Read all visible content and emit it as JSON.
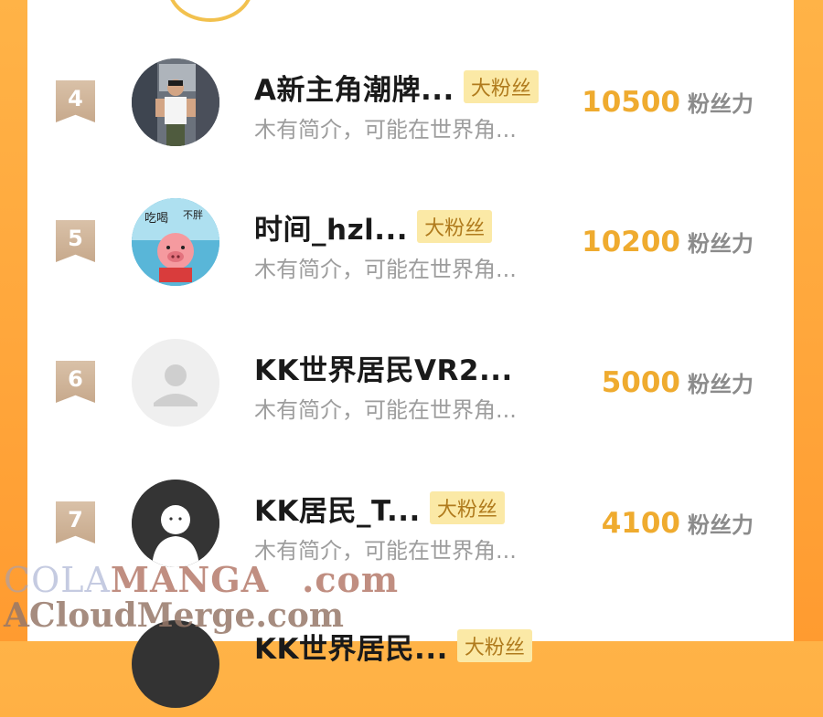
{
  "leaderboard": {
    "rows": [
      {
        "rank": "4",
        "name": "A新主角潮牌...",
        "tag": "大粉丝",
        "bio": "木有简介，可能在世界角...",
        "score": "10500",
        "unit": "粉丝力"
      },
      {
        "rank": "5",
        "name": "时间_hzl...",
        "tag": "大粉丝",
        "bio": "木有简介，可能在世界角...",
        "score": "10200",
        "unit": "粉丝力"
      },
      {
        "rank": "6",
        "name": "KK世界居民VR2...",
        "tag": "",
        "bio": "木有简介，可能在世界角...",
        "score": "5000",
        "unit": "粉丝力"
      },
      {
        "rank": "7",
        "name": "KK居民_T...",
        "tag": "大粉丝",
        "bio": "木有简介，可能在世界角...",
        "score": "4100",
        "unit": "粉丝力"
      },
      {
        "rank": "",
        "name": "KK世界居民...",
        "tag": "大粉丝",
        "bio": "",
        "score": "",
        "unit": ""
      }
    ]
  },
  "avatar5_text": {
    "left": "吃喝",
    "right": "不胖"
  },
  "watermark": {
    "line1_a": "COLA",
    "line1_b": "MANGA",
    "line1_c": ".com",
    "line2": "ACloudMerge.com"
  }
}
